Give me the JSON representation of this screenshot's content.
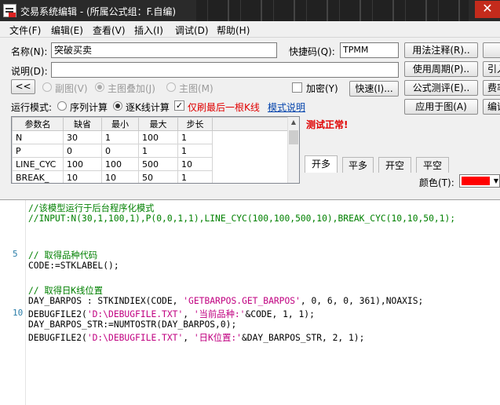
{
  "window": {
    "title": "交易系统编辑 - (所属公式组：F.自编)",
    "close_glyph": "✕"
  },
  "menu": [
    "文件(F)",
    "编辑(E)",
    "查看(V)",
    "插入(I)",
    "调试(D)",
    "帮助(H)"
  ],
  "form": {
    "name_label": "名称(N):",
    "name_value": "突破买卖",
    "shortcut_label": "快捷码(Q):",
    "shortcut_value": "TPMM",
    "desc_label": "说明(D):",
    "desc_value": "",
    "collapse_btn": "<<",
    "radio_subchart": "副图(V)",
    "radio_main_overlay": "主图叠加(J)",
    "radio_main": "主图(M)",
    "encrypt_label": "加密(Y)",
    "quick_btn": "快速(I)...",
    "run_mode_label": "运行模式:",
    "seq_calc": "序列计算",
    "kline_calc": "逐K线计算",
    "only_last_label": "仅刷最后一根K线",
    "mode_help_link": "模式说明"
  },
  "right_buttons": {
    "usage_note": "用法注释(R)..",
    "use_period": "使用周期(P)..",
    "formula_test": "公式测评(E)..",
    "apply_chart": "应用于图(A)",
    "edge_1": "",
    "edge_2": "引入",
    "edge_3": "费率",
    "edge_4": "编译"
  },
  "params": {
    "headers": [
      "参数名",
      "缺省",
      "最小",
      "最大",
      "步长"
    ],
    "rows": [
      [
        "N",
        "30",
        "1",
        "100",
        "1"
      ],
      [
        "P",
        "0",
        "0",
        "1",
        "1"
      ],
      [
        "LINE_CYC",
        "100",
        "100",
        "500",
        "10"
      ],
      [
        "BREAK_",
        "10",
        "10",
        "50",
        "1"
      ]
    ]
  },
  "status": {
    "text": "测试正常!",
    "color": "#e00000"
  },
  "tabs": [
    "开多",
    "平多",
    "开空",
    "平空"
  ],
  "color_label": "颜色(T):",
  "swatch_color": "#ff0000",
  "code": [
    {
      "ln": "",
      "text": "//该模型运行于后台程序化模式",
      "color": "#008000"
    },
    {
      "ln": "",
      "text": "//INPUT:N(30,1,100,1),P(0,0,1,1),LINE_CYC(100,100,500,10),BREAK_CYC(10,10,50,1);",
      "color": "#008000"
    },
    {
      "ln": "",
      "text": "",
      "color": "#000000"
    },
    {
      "ln": "",
      "text": "",
      "color": "#000000"
    },
    {
      "ln": "5",
      "text": "// 取得品种代码",
      "color": "#008000"
    },
    {
      "ln": "",
      "text": "CODE:=STKLABEL();",
      "color": "#000000"
    },
    {
      "ln": "",
      "text": "",
      "color": "#000000"
    },
    {
      "ln": "",
      "text": "// 取得日K线位置",
      "color": "#008000"
    },
    {
      "ln": "",
      "text": "DAY_BARPOS : STKINDIEX(CODE, 'GETBARPOS.GET_BARPOS', 0, 6, 0, 361),NOAXIS;",
      "color": "#000000"
    },
    {
      "ln": "10",
      "text": "DEBUGFILE2('D:\\DEBUGFILE.TXT', '当前品种:'&CODE, 1, 1);",
      "color": "#000000"
    },
    {
      "ln": "",
      "text": "DAY_BARPOS_STR:=NUMTOSTR(DAY_BARPOS,0);",
      "color": "#000000"
    },
    {
      "ln": "",
      "text": "DEBUGFILE2('D:\\DEBUGFILE.TXT', '日K位置:'&DAY_BARPOS_STR, 2, 1);",
      "color": "#000000"
    }
  ]
}
